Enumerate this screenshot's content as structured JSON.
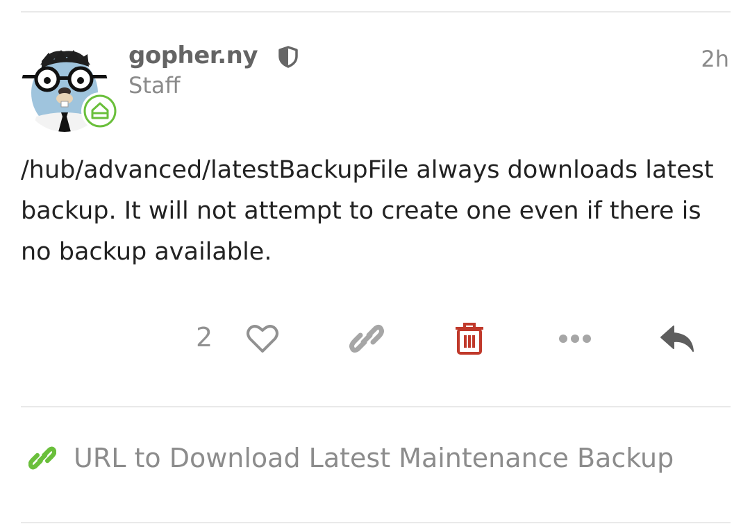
{
  "post": {
    "username": "gopher.ny",
    "user_title": "Staff",
    "time": "2h",
    "body": "/hub/advanced/latestBackupFile always downloads latest backup. It will not attempt to create one even if there is no backup available."
  },
  "actions": {
    "like_count": "2"
  },
  "linked_topic": {
    "title": "URL to Download Latest Maintenance Backup"
  },
  "colors": {
    "delete": "#c0392b",
    "flair": "#6abf3b",
    "link_icon": "#6abf3b",
    "divider": "#e9e9e9"
  },
  "icons": {
    "avatar": "gopher-avatar",
    "flair": "home-icon",
    "moderator": "shield-icon",
    "like": "heart-icon",
    "link": "link-icon",
    "delete": "trash-icon",
    "more": "ellipsis-icon",
    "reply": "reply-icon"
  }
}
